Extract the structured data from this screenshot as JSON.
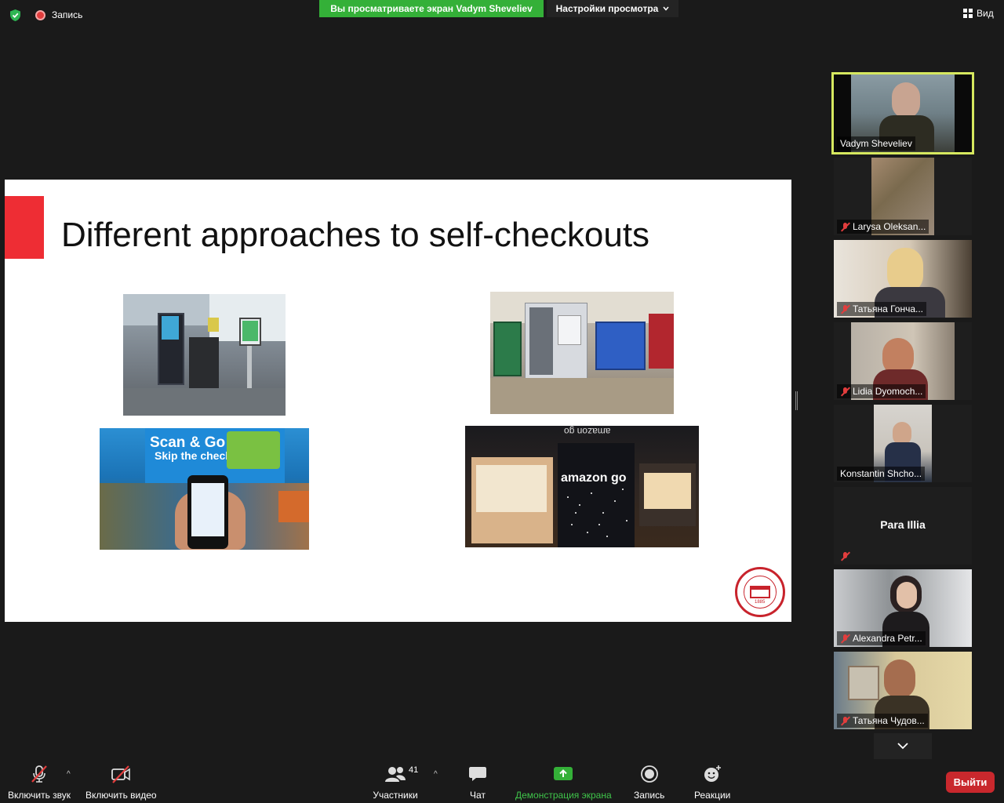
{
  "topbar": {
    "recording_label": "Запись",
    "share_banner": "Вы просматриваете экран Vadym Sheveliev",
    "view_settings": "Настройки просмотра",
    "view_button": "Вид"
  },
  "slide": {
    "title": "Different approaches to self-checkouts",
    "photo1_text": {
      "scan_title": "Scan & Go",
      "scan_sub": "Skip the checkout line."
    },
    "amazon_brand": "amazon go",
    "amazon_sign_top": "amazon go",
    "logo_year": "1885"
  },
  "participants": [
    {
      "name": "Vadym Sheveliev",
      "muted": false,
      "active": true
    },
    {
      "name": "Larysa Oleksan...",
      "muted": true
    },
    {
      "name": "Татьяна Гонча...",
      "muted": true
    },
    {
      "name": "Lidia Dyomoch...",
      "muted": true
    },
    {
      "name": "Konstantin Shcho...",
      "muted": false
    },
    {
      "name": "Para Illia",
      "muted": true,
      "no_video": true
    },
    {
      "name": "Alexandra Petr...",
      "muted": true
    },
    {
      "name": "Татьяна Чудов...",
      "muted": true
    }
  ],
  "toolbar": {
    "audio_label": "Включить звук",
    "video_label": "Включить видео",
    "participants_label": "Участники",
    "participants_count": "41",
    "chat_label": "Чат",
    "share_label": "Демонстрация экрана",
    "record_label": "Запись",
    "reactions_label": "Реакции",
    "leave_label": "Выйти"
  },
  "colors": {
    "share_banner": "#34b038",
    "active_speaker_border": "#d6e85f",
    "leave_button": "#c9282d",
    "slide_accent": "#ee2d34"
  }
}
